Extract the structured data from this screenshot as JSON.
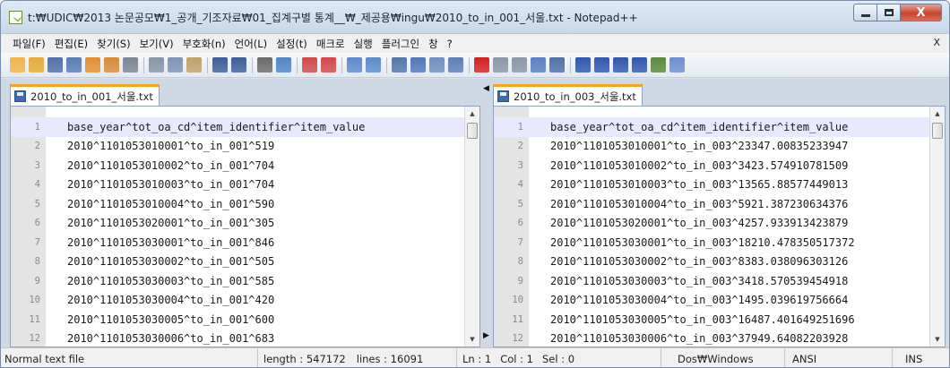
{
  "window": {
    "title": "t:₩UDIC₩2013 논문공모₩1_공개_기조자료₩01_집계구별 통계__₩_제공용₩ingu₩2010_to_in_001_서울.txt - Notepad++",
    "close_glyph": "X"
  },
  "menu": {
    "items": [
      "파일(F)",
      "편집(E)",
      "찾기(S)",
      "보기(V)",
      "부호화(n)",
      "언어(L)",
      "설정(t)",
      "매크로",
      "실행",
      "플러그인",
      "창",
      "?"
    ],
    "close_doc": "X"
  },
  "toolbar": {
    "buttons": [
      {
        "icon": "new-file-icon",
        "color": "#f0b54b"
      },
      {
        "icon": "open-file-icon",
        "color": "#e9a93b"
      },
      {
        "icon": "save-icon",
        "color": "#4d6fa9"
      },
      {
        "icon": "save-all-icon",
        "color": "#5a7bb3"
      },
      {
        "icon": "close-icon",
        "color": "#e58f2e"
      },
      {
        "icon": "close-all-icon",
        "color": "#d98b36"
      },
      {
        "icon": "print-icon",
        "color": "#7b8594"
      },
      {
        "sep": true
      },
      {
        "icon": "cut-icon",
        "color": "#8795a8"
      },
      {
        "icon": "copy-icon",
        "color": "#7e93b6"
      },
      {
        "icon": "paste-icon",
        "color": "#c1a06a"
      },
      {
        "sep": true
      },
      {
        "icon": "undo-icon",
        "color": "#3d5f98"
      },
      {
        "icon": "redo-icon",
        "color": "#3d5f98"
      },
      {
        "sep": true
      },
      {
        "icon": "find-icon",
        "color": "#6b6b6b"
      },
      {
        "icon": "replace-icon",
        "color": "#4e86c6"
      },
      {
        "sep": true
      },
      {
        "icon": "zoom-in-icon",
        "color": "#d34848"
      },
      {
        "icon": "zoom-out-icon",
        "color": "#d34848"
      },
      {
        "sep": true
      },
      {
        "icon": "sync-vertical-icon",
        "color": "#5c8cc9"
      },
      {
        "icon": "sync-horizontal-icon",
        "color": "#5c8cc9"
      },
      {
        "sep": true
      },
      {
        "icon": "word-wrap-icon",
        "color": "#5176ad"
      },
      {
        "icon": "show-all-chars-icon",
        "color": "#4f78b8"
      },
      {
        "icon": "indent-guide-icon",
        "color": "#6e8fbf"
      },
      {
        "icon": "function-list-icon",
        "color": "#5d7fb6"
      },
      {
        "sep": true
      },
      {
        "icon": "record-macro-icon",
        "color": "#d32020"
      },
      {
        "icon": "stop-macro-icon",
        "color": "#8b96a8"
      },
      {
        "icon": "play-macro-icon",
        "color": "#8b96a8"
      },
      {
        "icon": "run-macro-multiple-icon",
        "color": "#5b7fc0"
      },
      {
        "icon": "save-macro-icon",
        "color": "#4d6fa9"
      },
      {
        "sep": true
      },
      {
        "icon": "fold-all-icon",
        "color": "#3058b0"
      },
      {
        "icon": "up-icon",
        "color": "#3058b0"
      },
      {
        "icon": "down-icon",
        "color": "#3058b0"
      },
      {
        "icon": "unfold-icon",
        "color": "#3058b0"
      },
      {
        "icon": "doc-map-icon",
        "color": "#5a8a3c"
      },
      {
        "icon": "spell-check-icon",
        "color": "#6c8fd0"
      }
    ]
  },
  "editor": {
    "left": {
      "tab": "2010_to_in_001_서울.txt",
      "lines": [
        {
          "n": "1",
          "text": "base_year^tot_oa_cd^item_identifier^item_value",
          "active": true
        },
        {
          "n": "2",
          "text": "2010^1101053010001^to_in_001^519"
        },
        {
          "n": "3",
          "text": "2010^1101053010002^to_in_001^704"
        },
        {
          "n": "4",
          "text": "2010^1101053010003^to_in_001^704"
        },
        {
          "n": "5",
          "text": "2010^1101053010004^to_in_001^590"
        },
        {
          "n": "6",
          "text": "2010^1101053020001^to_in_001^305"
        },
        {
          "n": "7",
          "text": "2010^1101053030001^to_in_001^846"
        },
        {
          "n": "8",
          "text": "2010^1101053030002^to_in_001^505"
        },
        {
          "n": "9",
          "text": "2010^1101053030003^to_in_001^585"
        },
        {
          "n": "10",
          "text": "2010^1101053030004^to_in_001^420"
        },
        {
          "n": "11",
          "text": "2010^1101053030005^to_in_001^600"
        },
        {
          "n": "12",
          "text": "2010^1101053030006^to_in_001^683"
        }
      ]
    },
    "right": {
      "tab": "2010_to_in_003_서울.txt",
      "lines": [
        {
          "n": "1",
          "text": "base_year^tot_oa_cd^item_identifier^item_value",
          "active": true
        },
        {
          "n": "2",
          "text": "2010^1101053010001^to_in_003^23347.00835233947"
        },
        {
          "n": "3",
          "text": "2010^1101053010002^to_in_003^3423.574910781509"
        },
        {
          "n": "4",
          "text": "2010^1101053010003^to_in_003^13565.88577449013"
        },
        {
          "n": "5",
          "text": "2010^1101053010004^to_in_003^5921.387230634376"
        },
        {
          "n": "6",
          "text": "2010^1101053020001^to_in_003^4257.933913423879"
        },
        {
          "n": "7",
          "text": "2010^1101053030001^to_in_003^18210.478350517372"
        },
        {
          "n": "8",
          "text": "2010^1101053030002^to_in_003^8383.038096303126"
        },
        {
          "n": "9",
          "text": "2010^1101053030003^to_in_003^3418.570539454918"
        },
        {
          "n": "10",
          "text": "2010^1101053030004^to_in_003^1495.039619756664"
        },
        {
          "n": "11",
          "text": "2010^1101053030005^to_in_003^16487.401649251696"
        },
        {
          "n": "12",
          "text": "2010^1101053030006^to_in_003^37949.64082203928"
        }
      ]
    }
  },
  "status": {
    "filetype": "Normal text file",
    "length": "length : 547172",
    "lines": "lines : 16091",
    "ln": "Ln : 1",
    "col": "Col : 1",
    "sel": "Sel : 0",
    "eol": "Dos₩Windows",
    "encoding": "ANSI",
    "mode": "INS"
  }
}
